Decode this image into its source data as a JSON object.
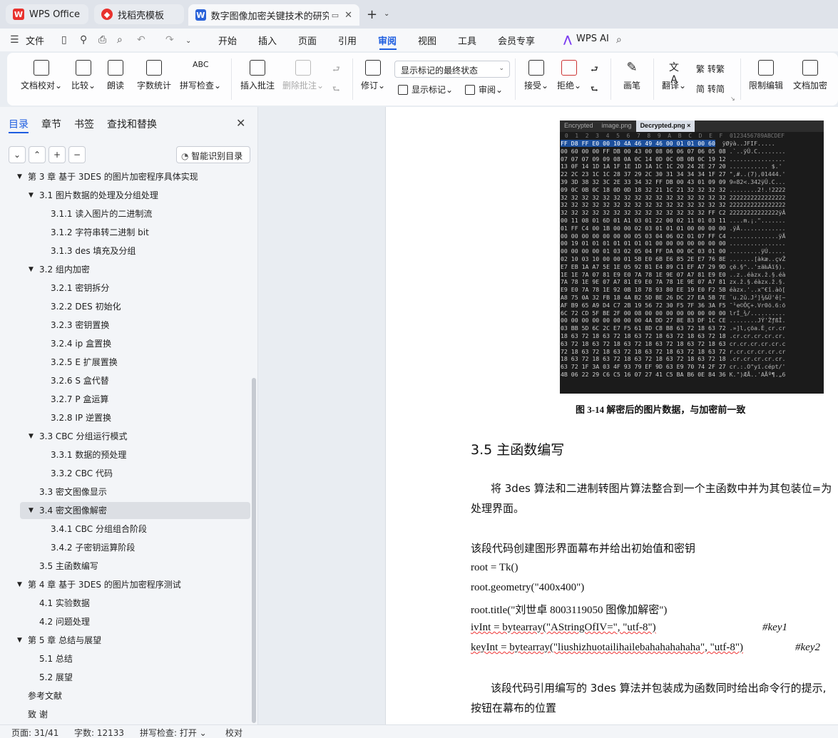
{
  "tabs": [
    {
      "label": "WPS Office",
      "icon": "wps-logo-icon"
    },
    {
      "label": "找稻壳模板",
      "icon": "docer-icon"
    },
    {
      "label": "数字图像加密关键技术的研究...",
      "icon": "word-doc-icon"
    }
  ],
  "menu": {
    "file": "文件",
    "items": [
      "开始",
      "插入",
      "页面",
      "引用",
      "审阅",
      "视图",
      "工具",
      "会员专享"
    ],
    "active": "审阅",
    "wps_ai": "WPS AI"
  },
  "ribbon": {
    "doc_proof": "文档校对",
    "compare": "比较",
    "read_aloud": "朗读",
    "word_count": "字数统计",
    "spell_check": "拼写检查",
    "insert_comment": "插入批注",
    "delete_comment": "删除批注",
    "revise": "修订",
    "markup_state": "显示标记的最终状态",
    "show_markup": "显示标记",
    "review": "审阅",
    "accept": "接受",
    "reject": "拒绝",
    "pen": "画笔",
    "translate": "翻译",
    "to_traditional": "转繁",
    "to_simplified": "转简",
    "restrict_edit": "限制编辑",
    "doc_encrypt": "文档加密"
  },
  "nav": {
    "tabs": [
      "目录",
      "章节",
      "书签",
      "查找和替换"
    ],
    "smart_toc": "智能识别目录",
    "toc": [
      {
        "text": "第 3 章  基于 3DES 的图片加密程序具体实现",
        "level": 0,
        "tri": true
      },
      {
        "text": "3.1 图片数据的处理及分组处理",
        "level": 1,
        "tri": true
      },
      {
        "text": "3.1.1 读入图片的二进制流",
        "level": 2
      },
      {
        "text": "3.1.2 字符串转二进制 bit",
        "level": 2
      },
      {
        "text": "3.1.3 des 填充及分组",
        "level": 2
      },
      {
        "text": "3.2  组内加密",
        "level": 1,
        "tri": true
      },
      {
        "text": "3.2.1  密钥拆分",
        "level": 2
      },
      {
        "text": "3.2.2 DES 初始化",
        "level": 2
      },
      {
        "text": "3.2.3  密钥置换",
        "level": 2
      },
      {
        "text": "3.2.4 ip 盒置换",
        "level": 2
      },
      {
        "text": "3.2.5 E 扩展置换",
        "level": 2
      },
      {
        "text": "3.2.6 S 盒代替",
        "level": 2
      },
      {
        "text": "3.2.7 P 盒运算",
        "level": 2
      },
      {
        "text": "3.2.8 IP 逆置换",
        "level": 2
      },
      {
        "text": "3.3 CBC 分组运行模式",
        "level": 1,
        "tri": true
      },
      {
        "text": "3.3.1  数据的预处理",
        "level": 2
      },
      {
        "text": "3.3.2 CBC 代码",
        "level": 2
      },
      {
        "text": "3.3  密文图像显示",
        "level": 1
      },
      {
        "text": "3.4  密文图像解密",
        "level": 1,
        "tri": true,
        "selected": true
      },
      {
        "text": "3.4.1 CBC 分组组合阶段",
        "level": 2
      },
      {
        "text": "3.4.2  子密钥运算阶段",
        "level": 2
      },
      {
        "text": "3.5  主函数编写",
        "level": 1
      },
      {
        "text": "第 4 章  基于 3DES 的图片加密程序测试",
        "level": 0,
        "tri": true
      },
      {
        "text": "4.1 实验数据",
        "level": 1
      },
      {
        "text": "4.2 问题处理",
        "level": 1
      },
      {
        "text": "第 5 章  总结与展望",
        "level": 0,
        "tri": true
      },
      {
        "text": "5.1  总结",
        "level": 1
      },
      {
        "text": "5.2  展望",
        "level": 1
      },
      {
        "text": "参考文献",
        "level": 0
      },
      {
        "text": "致    谢",
        "level": 0
      }
    ]
  },
  "hex": {
    "tabs": [
      "Encrypted",
      "image.png",
      "Decrypted.png ×"
    ],
    "header": " 0  1  2  3  4  5  6  7  8  9  A  B  C  D  E  F  0123456789ABCDEF",
    "rows": [
      [
        "FF D8 FF E0 00 10 4A 46 49 46 00 01 01 00 60",
        " ÿØÿà..JFIF....."
      ],
      [
        "00 60 00 00 FF DB 00 43 00 08 06 06 07 06 05 08",
        ".`..ÿÛ.C........"
      ],
      [
        "07 07 07 09 09 08 0A 0C 14 0D 0C 0B 0B 0C 19 12",
        "................"
      ],
      [
        "13 0F 14 1D 1A 1F 1E 1D 1A 1C 1C 20 24 2E 27 20",
        "........... $.' "
      ],
      [
        "22 2C 23 1C 1C 28 37 29 2C 30 31 34 34 34 1F 27",
        "\",#..(7),01444.'"
      ],
      [
        "39 3D 38 32 3C 2E 33 34 32 FF DB 00 43 01 09 09",
        "9=82<.342ÿÛ.C..."
      ],
      [
        "09 0C 0B 0C 18 0D 0D 18 32 21 1C 21 32 32 32 32",
        "........2!.!2222"
      ],
      [
        "32 32 32 32 32 32 32 32 32 32 32 32 32 32 32 32",
        "2222222222222222"
      ],
      [
        "32 32 32 32 32 32 32 32 32 32 32 32 32 32 32 32",
        "2222222222222222"
      ],
      [
        "32 32 32 32 32 32 32 32 32 32 32 32 32 32 FF C2",
        "22222222222222ÿÂ"
      ],
      [
        "00 11 08 01 6D 01 A1 03 01 22 00 02 11 01 03 11",
        "....m.¡.\"......."
      ],
      [
        "01 FF C4 00 1B 00 00 02 03 01 01 01 00 00 00 00",
        ".ÿÄ............."
      ],
      [
        "00 00 00 00 00 00 00 05 03 04 06 02 01 07 FF C4",
        "..............ÿÄ"
      ],
      [
        "00 19 01 01 01 01 01 01 01 00 00 00 00 00 00 00",
        "................"
      ],
      [
        "00 00 00 00 01 03 02 05 04 FF DA 00 0C 03 01 00",
        ".........ÿÚ....."
      ],
      [
        "02 10 03 10 00 00 01 5B E0 6B E6 85 2E E7 76 8E",
        ".......[àkæ..çvŽ"
      ],
      [
        "E7 EB 1A A7 5E 1E 05 92 B1 E4 89 C1 EF A7 29 9D",
        "çë.§^..'±ä‰Áï§)."
      ],
      [
        "1E 1E 7A 07 81 E9 E0 7A 78 1E 9E 07 A7 81 E9 E0",
        "..z..éàzx.ž.§.éà"
      ],
      [
        "7A 78 1E 9E 07 A7 81 E9 E0 7A 78 1E 9E 07 A7 81",
        "zx.ž.§.éàzx.ž.§."
      ],
      [
        "E9 E0 7A 78 1E 92 0B 18 78 93 80 EE 19 E0 F2 5B",
        "éàzx.'..x\"€î.àò["
      ],
      [
        "A8 75 0A 32 FB 18 4A B2 5D BE 26 DC 27 EA 5B 7E",
        "¨u.2û.J²]¾&Ü'ê[~"
      ],
      [
        "AF B9 65 A9 D4 C7 2B 19 56 72 30 F5 7F 36 3A F5",
        "¯¹e©ÔÇ+.Vr0õ.6:õ"
      ],
      [
        "6C 72 CD 5F BE 2F 00 08 00 00 00 00 00 00 00 00",
        "lrÍ_¾/.........."
      ],
      [
        "00 00 00 00 00 00 00 00 4A DD 27 8E 83 DF 1C CE",
        "........JÝ'ŽƒßÎ."
      ],
      [
        "03 BB 5D 6C 2C E7 F5 61 8D C8 B8 63 72 18 63 72",
        ".»]l,çõa.È¸cr.cr"
      ],
      [
        "18 63 72 18 63 72 18 63 72 18 63 72 18 63 72 18",
        ".cr.cr.cr.cr.cr."
      ],
      [
        "63 72 18 63 72 18 63 72 18 63 72 18 63 72 18 63",
        "cr.cr.cr.cr.cr.c"
      ],
      [
        "72 18 63 72 18 63 72 18 63 72 18 63 72 18 63 72",
        "r.cr.cr.cr.cr.cr"
      ],
      [
        "18 63 72 18 63 72 18 63 72 18 63 72 18 63 72 18",
        ".cr.cr.cr.cr.cr."
      ],
      [
        "63 72 1F 3A 03 4F 93 79 EF 9D 63 E9 70 74 2F 27",
        "cr.:.O\"yï.cépt/'"
      ],
      [
        "4B 06 22 29 C6 C5 16 07 27 41 C5 BA B6 0E 84 36",
        "K.\")ÆÅ..'AÅº¶.„6"
      ]
    ]
  },
  "doc": {
    "caption": "图 3-14  解密后的图片数据，与加密前一致",
    "heading": "3.5  主函数编写",
    "para1_line1": "将 3des 算法和二进制转图片算法整合到一个主函数中并为其包装位=为",
    "para1_line2": "处理界面。",
    "para2": "该段代码创建图形界面幕布并给出初始值和密钥",
    "code1": "root = Tk()",
    "code2": "root.geometry(\"400x400\")",
    "code3": "root.title(\"刘世卓 8003119050 图像加解密\")",
    "code4": "ivInt = bytearray(\"AStringOfIV=\", \"utf-8\")",
    "comment4": "#key1",
    "code5": "keyInt = bytearray(\"liushizhuotailihailebahahahahaha\", \"utf-8\")",
    "comment5": "#key2",
    "para3_line1": "该段代码引用编写的 3des 算法并包装成为函数同时给出命令行的提示,",
    "para3_line2": "按钮在幕布的位置"
  },
  "status": {
    "page": "页面: 31/41",
    "words": "字数: 12133",
    "spell": "拼写检查: 打开 ⌄",
    "proof": "校对"
  },
  "colors": {
    "accent": "#1d5de0",
    "wps_red": "#e8322e"
  }
}
